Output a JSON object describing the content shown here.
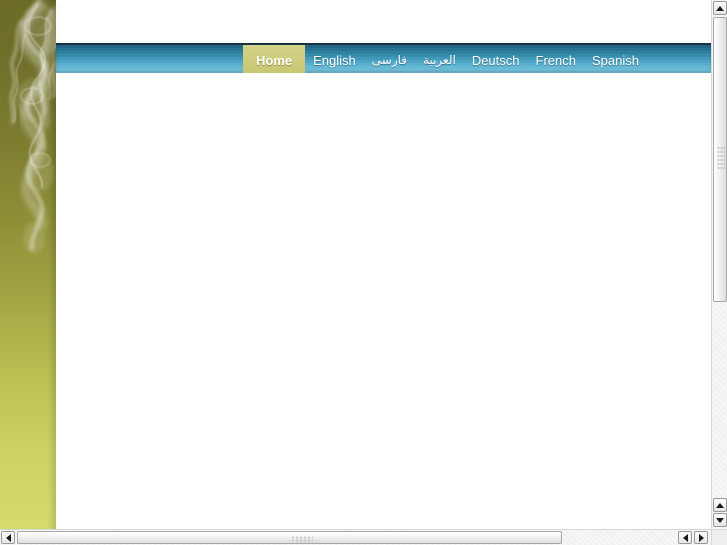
{
  "page": {
    "background_olive_top": "#6b6b28",
    "background_olive_bottom": "#d5da6d",
    "content_background": "#ffffff"
  },
  "nav": {
    "bar_color_top": "#1d5d80",
    "bar_color_bottom": "#72c2dc",
    "active_color": "#cdcd7c",
    "text_color": "#ffffff",
    "items": [
      {
        "label": "Home",
        "active": true,
        "rtl": false
      },
      {
        "label": "English",
        "active": false,
        "rtl": false
      },
      {
        "label": "فارسی",
        "active": false,
        "rtl": true
      },
      {
        "label": "العربية",
        "active": false,
        "rtl": true
      },
      {
        "label": "Deutsch",
        "active": false,
        "rtl": false
      },
      {
        "label": "French",
        "active": false,
        "rtl": false
      },
      {
        "label": "Spanish",
        "active": false,
        "rtl": false
      }
    ]
  },
  "scrollbars": {
    "vertical": {
      "up_arrow": "▲",
      "down_arrow": "▼"
    },
    "horizontal": {
      "left_arrow": "◀",
      "right_arrow": "▶"
    }
  }
}
